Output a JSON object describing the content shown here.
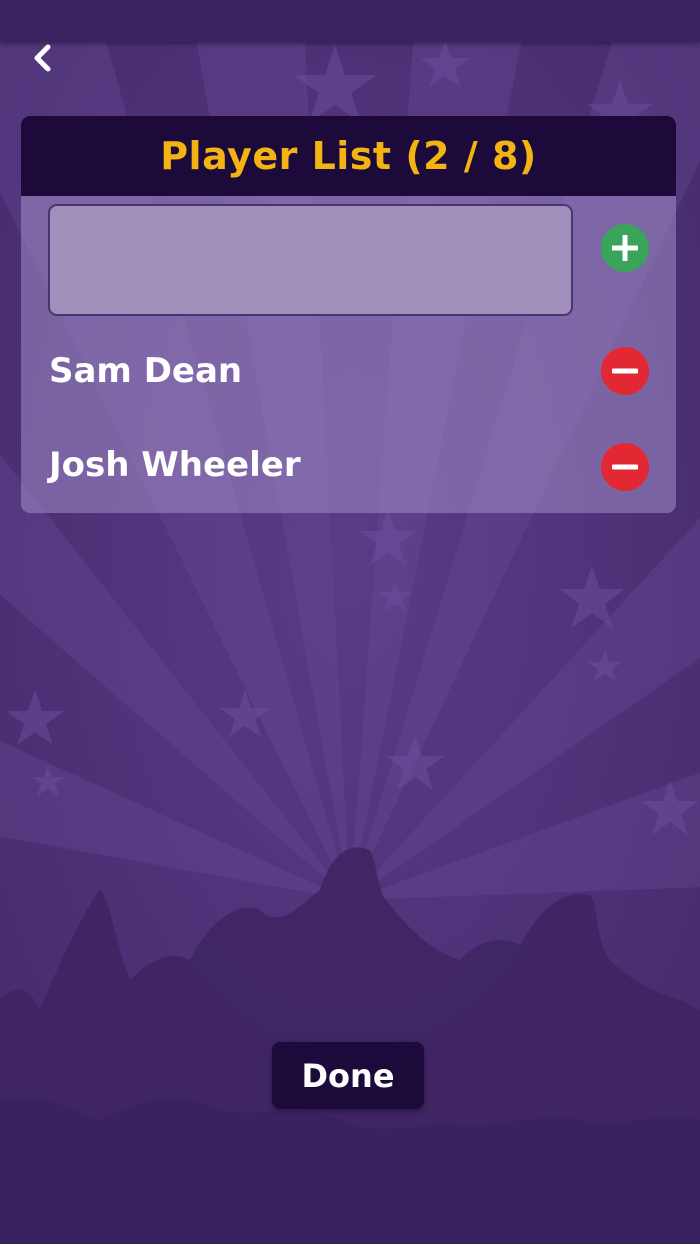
{
  "colors": {
    "background": "#4a2d74",
    "header_bg": "#1c0b3a",
    "title_color": "#f3b413",
    "add_button": "#39a55b",
    "remove_button": "#e22933"
  },
  "panel": {
    "title": "Player List (2 / 8)"
  },
  "new_player_input": {
    "value": "",
    "placeholder": ""
  },
  "players": [
    {
      "name": "Sam Dean"
    },
    {
      "name": "Josh Wheeler"
    }
  ],
  "icons": {
    "back": "chevron-left-icon",
    "add": "plus-icon",
    "remove": "minus-icon"
  },
  "done_label": "Done"
}
